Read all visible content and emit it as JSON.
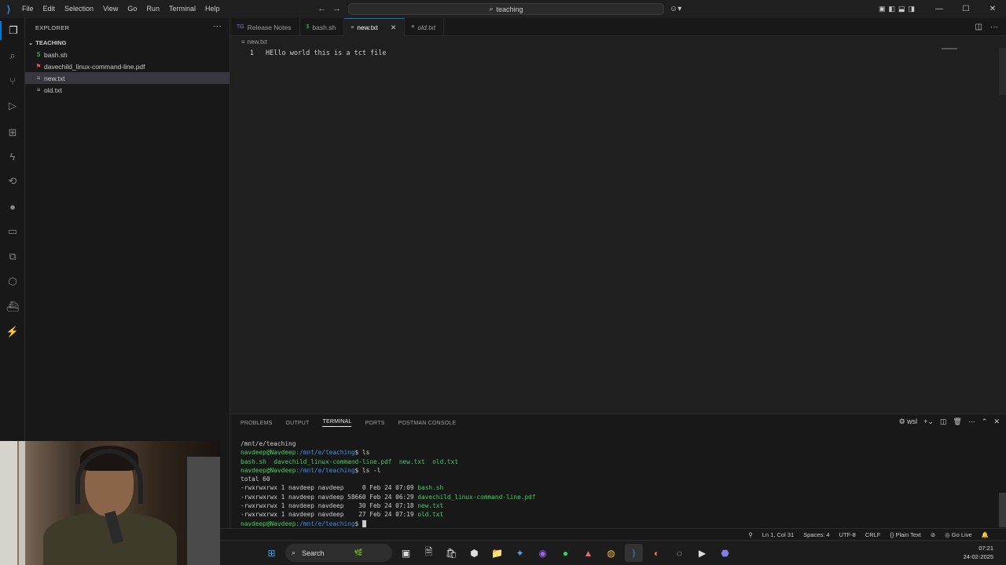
{
  "titlebar": {
    "menu": [
      "File",
      "Edit",
      "Selection",
      "View",
      "Go",
      "Run",
      "Terminal",
      "Help"
    ],
    "search_text": "teaching"
  },
  "sidebar": {
    "header": "EXPLORER",
    "folder": "TEACHING",
    "files": [
      {
        "name": "bash.sh",
        "icon": "$",
        "icon_color": "#3fb950"
      },
      {
        "name": "davechild_linux-command-line.pdf",
        "icon": "⚑",
        "icon_color": "#e5534b"
      },
      {
        "name": "new.txt",
        "icon": "≡",
        "icon_color": "#aaaaaa"
      },
      {
        "name": "old.txt",
        "icon": "≡",
        "icon_color": "#aaaaaa"
      }
    ]
  },
  "tabs": [
    {
      "label": "Release Notes",
      "icon": "TG",
      "icon_color": "#7b6fd1"
    },
    {
      "label": "bash.sh",
      "icon": "$",
      "icon_color": "#3fb950"
    },
    {
      "label": "new.txt",
      "icon": "≡",
      "icon_color": "#aaaaaa"
    },
    {
      "label": "old.txt",
      "icon": "≡",
      "icon_color": "#aaaaaa"
    }
  ],
  "editor": {
    "breadcrumb": "new.txt",
    "line_number": "1",
    "line_text": "HEllo world this is a tct file"
  },
  "panel": {
    "tabs": [
      "PROBLEMS",
      "OUTPUT",
      "TERMINAL",
      "PORTS",
      "POSTMAN CONSOLE"
    ],
    "shell": "wsl",
    "terminal": {
      "cwd": "/mnt/e/teaching",
      "prompt_user": "navdeep@Navdeep",
      "prompt_path": ":/mnt/e/teaching",
      "prompt_sym": "$",
      "cmd1": " ls",
      "ls_out": [
        "bash.sh",
        "davechild_linux-command-line.pdf",
        "new.txt",
        "old.txt"
      ],
      "cmd2": " ls -l",
      "total": "total 60",
      "rows": [
        {
          "meta": "-rwxrwxrwx 1 navdeep navdeep     0 Feb 24 07:09 ",
          "name": "bash.sh"
        },
        {
          "meta": "-rwxrwxrwx 1 navdeep navdeep 58660 Feb 24 06:29 ",
          "name": "davechild_linux-command-line.pdf"
        },
        {
          "meta": "-rwxrwxrwx 1 navdeep navdeep    30 Feb 24 07:18 ",
          "name": "new.txt"
        },
        {
          "meta": "-rwxrwxrwx 1 navdeep navdeep    27 Feb 24 07:19 ",
          "name": "old.txt"
        }
      ]
    }
  },
  "statusbar": {
    "cursor": "Ln 1, Col 31",
    "spaces": "Spaces: 4",
    "encoding": "UTF-8",
    "eol": "CRLF",
    "language": "{} Plain Text",
    "golive": "Go Live"
  },
  "taskbar": {
    "search": "Search",
    "time": "07:21",
    "date": "24-02-2025"
  }
}
